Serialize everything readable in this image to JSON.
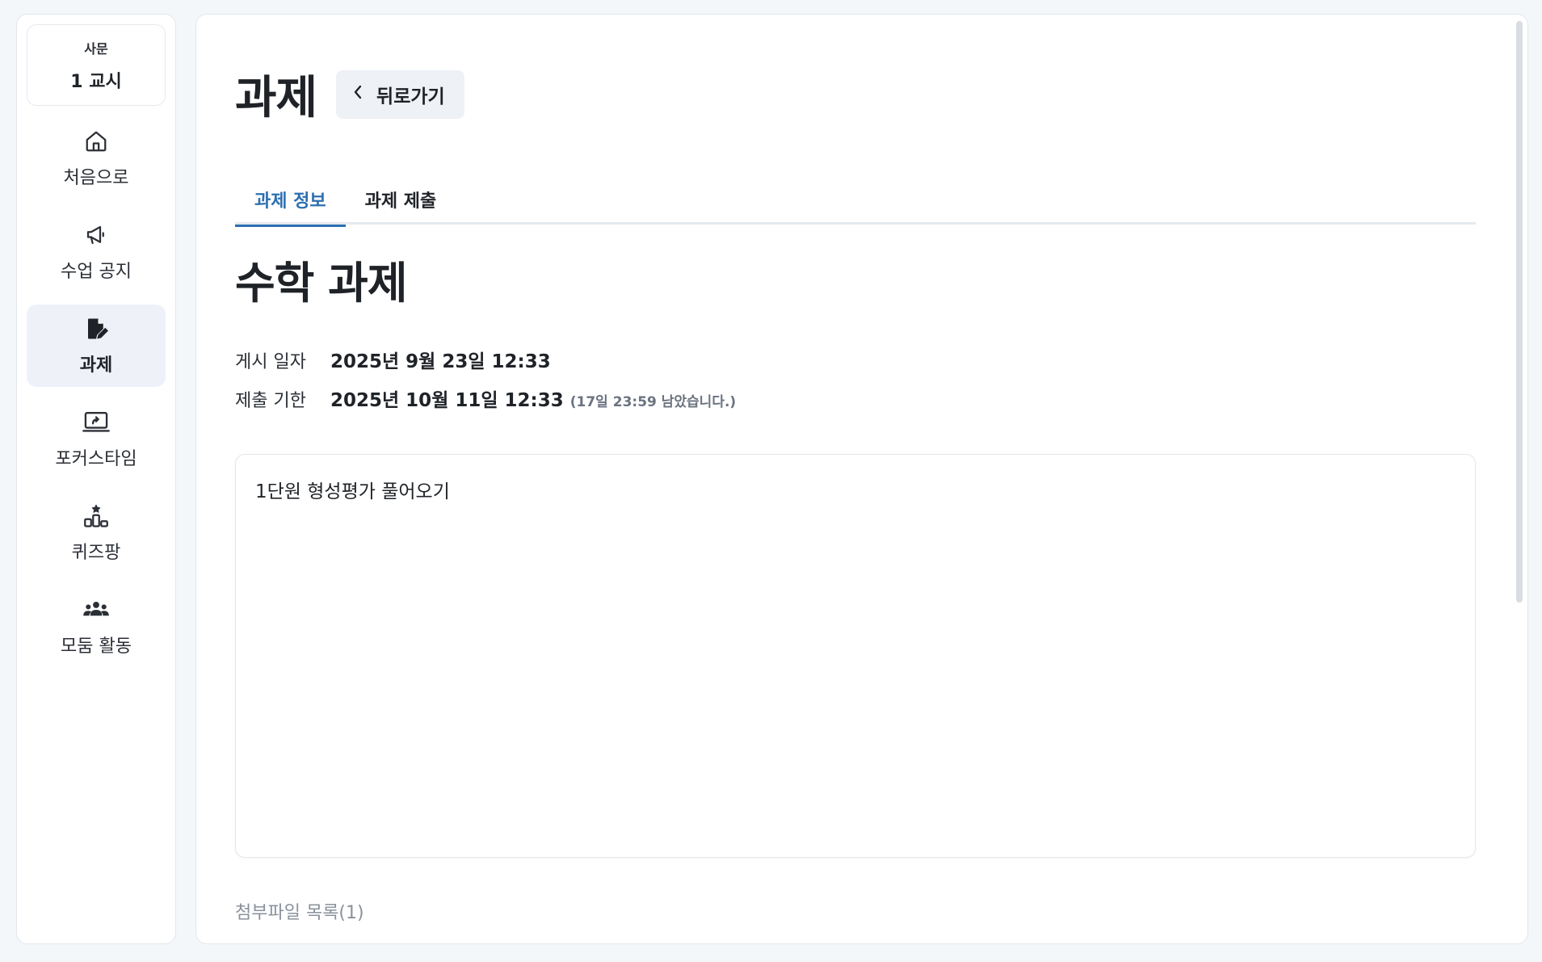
{
  "sidebar": {
    "class": {
      "subject": "사문",
      "period": "1 교시"
    },
    "items": [
      {
        "label": "처음으로",
        "icon": "home-icon"
      },
      {
        "label": "수업 공지",
        "icon": "megaphone-icon"
      },
      {
        "label": "과제",
        "icon": "edit-note-icon",
        "active": true
      },
      {
        "label": "포커스타임",
        "icon": "screen-share-icon"
      },
      {
        "label": "퀴즈팡",
        "icon": "podium-icon"
      },
      {
        "label": "모둠 활동",
        "icon": "group-icon"
      }
    ]
  },
  "header": {
    "title": "과제",
    "back_label": "뒤로가기"
  },
  "tabs": [
    {
      "label": "과제 정보",
      "active": true
    },
    {
      "label": "과제 제출",
      "active": false
    }
  ],
  "assignment": {
    "title": "수학 과제",
    "posted_label": "게시 일자",
    "posted_value": "2025년 9월 23일 12:33",
    "due_label": "제출 기한",
    "due_value": "2025년 10월 11일 12:33",
    "remaining": "(17일 23:59 남았습니다.)",
    "content": "1단원 형성평가 풀어오기"
  },
  "attachments": {
    "label": "첨부파일 목록(1)"
  },
  "colors": {
    "accent": "#2d6fb0",
    "active_bg": "#eef2f8"
  }
}
